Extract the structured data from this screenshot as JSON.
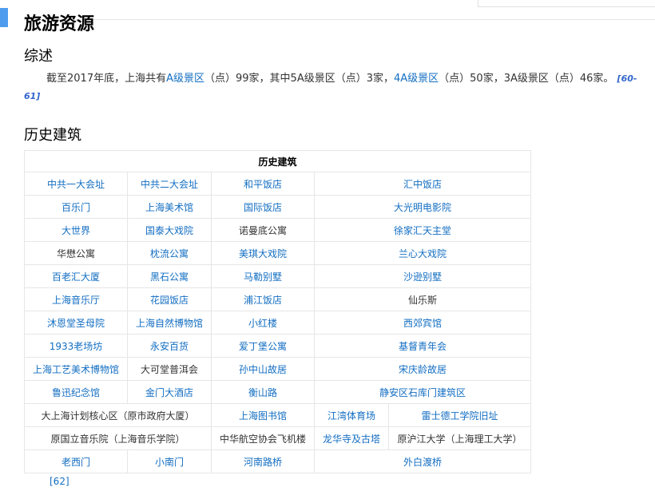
{
  "section": {
    "title": "旅游资源",
    "overview_title": "综述",
    "overview": {
      "t1": "截至2017年底，上海共有",
      "l1": "A级景区",
      "t2": "（点）99家，其中5A级景区（点）3家，",
      "l2": "4A级景区",
      "t3": "（点）50家，3A级景区（点）46家。",
      "cite": "[60-61]"
    },
    "history_title": "历史建筑"
  },
  "table": {
    "caption": "历史建筑",
    "rows": [
      [
        {
          "text": "中共一大会址",
          "link": true
        },
        {
          "text": "中共二大会址",
          "link": true
        },
        {
          "text": "和平饭店",
          "link": true
        },
        {
          "text": "汇中饭店",
          "link": true,
          "colspan": 2
        }
      ],
      [
        {
          "text": "百乐门",
          "link": true
        },
        {
          "text": "上海美术馆",
          "link": true
        },
        {
          "text": "国际饭店",
          "link": true
        },
        {
          "text": "大光明电影院",
          "link": true,
          "colspan": 2
        }
      ],
      [
        {
          "text": "大世界",
          "link": true
        },
        {
          "text": "国泰大戏院",
          "link": true
        },
        {
          "text": "诺曼底公寓",
          "link": false
        },
        {
          "text": "徐家汇天主堂",
          "link": true,
          "colspan": 2
        }
      ],
      [
        {
          "text": "华懋公寓",
          "link": false
        },
        {
          "text": "枕流公寓",
          "link": true
        },
        {
          "text": "美琪大戏院",
          "link": true
        },
        {
          "text": "兰心大戏院",
          "link": true,
          "colspan": 2
        }
      ],
      [
        {
          "text": "百老汇大厦",
          "link": true
        },
        {
          "text": "黑石公寓",
          "link": true
        },
        {
          "text": "马勒别墅",
          "link": true
        },
        {
          "text": "沙逊别墅",
          "link": true,
          "colspan": 2
        }
      ],
      [
        {
          "text": "上海音乐厅",
          "link": true
        },
        {
          "text": "花园饭店",
          "link": true
        },
        {
          "text": "浦江饭店",
          "link": true
        },
        {
          "text": "仙乐斯",
          "link": false,
          "colspan": 2
        }
      ],
      [
        {
          "text": "沐恩堂圣母院",
          "link": true
        },
        {
          "text": "上海自然博物馆",
          "link": true
        },
        {
          "text": "小红楼",
          "link": true
        },
        {
          "text": "西郊宾馆",
          "link": true,
          "colspan": 2
        }
      ],
      [
        {
          "text": "1933老场坊",
          "link": true
        },
        {
          "text": "永安百货",
          "link": true
        },
        {
          "text": "爱丁堡公寓",
          "link": true
        },
        {
          "text": "基督青年会",
          "link": true,
          "colspan": 2
        }
      ],
      [
        {
          "text": "上海工艺美术博物馆",
          "link": true
        },
        {
          "text": "大可堂普洱会",
          "link": false
        },
        {
          "text": "孙中山故居",
          "link": true
        },
        {
          "text": "宋庆龄故居",
          "link": true,
          "colspan": 2
        }
      ],
      [
        {
          "text": "鲁迅纪念馆",
          "link": true
        },
        {
          "text": "金门大酒店",
          "link": true
        },
        {
          "text": "衡山路",
          "link": true
        },
        {
          "text": "静安区石库门建筑区",
          "link": true,
          "colspan": 2
        }
      ],
      [
        {
          "text": "大上海计划核心区（原市政府大厦）",
          "link": false,
          "colspan": 2
        },
        {
          "text": "上海图书馆",
          "link": true
        },
        {
          "text": "江湾体育场",
          "link": true
        },
        {
          "text": "雷士德工学院旧址",
          "link": true
        }
      ],
      [
        {
          "text": "原国立音乐院（上海音乐学院）",
          "link": false,
          "colspan": 2
        },
        {
          "text": "中华航空协会飞机楼",
          "link": false
        },
        {
          "text": "龙华寺及古塔",
          "link": true
        },
        {
          "text": "原沪江大学（上海理工大学）",
          "link": false
        }
      ],
      [
        {
          "text": "老西门",
          "link": true
        },
        {
          "text": "小南门",
          "link": true
        },
        {
          "text": "河南路桥",
          "link": true
        },
        {
          "text": "外白渡桥",
          "link": true,
          "colspan": 2
        }
      ]
    ]
  },
  "bottom_cite": "[62]"
}
